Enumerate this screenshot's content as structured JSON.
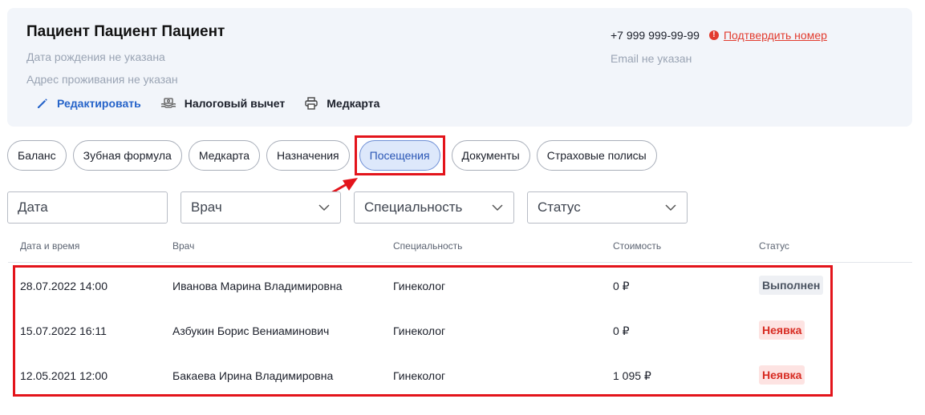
{
  "patient": {
    "name": "Пациент Пациент Пациент",
    "birth_date": "Дата рождения не указана",
    "address": "Адрес проживания не указан",
    "phone": "+7 999 999-99-99",
    "confirm_link": "Подтвердить номер",
    "email": "Email не указан",
    "warn_glyph": "!"
  },
  "actions": {
    "edit": "Редактировать",
    "tax": "Налоговый вычет",
    "medcard": "Медкарта"
  },
  "tabs": [
    {
      "label": "Баланс"
    },
    {
      "label": "Зубная формула"
    },
    {
      "label": "Медкарта"
    },
    {
      "label": "Назначения"
    },
    {
      "label": "Посещения",
      "active": true
    },
    {
      "label": "Документы"
    },
    {
      "label": "Страховые полисы"
    }
  ],
  "filters": {
    "date_placeholder": "Дата",
    "doctor": "Врач",
    "specialty": "Специальность",
    "status": "Статус"
  },
  "table": {
    "headers": [
      "Дата и время",
      "Врач",
      "Специальность",
      "Стоимость",
      "Статус"
    ],
    "rows": [
      {
        "datetime": "28.07.2022 14:00",
        "doctor": "Иванова Марина Владимировна",
        "specialty": "Гинеколог",
        "cost": "0 ₽",
        "status": "Выполнен"
      },
      {
        "datetime": "15.07.2022 16:11",
        "doctor": "Азбукин Борис Вениаминович",
        "specialty": "Гинеколог",
        "cost": "0 ₽",
        "status": "Неявка"
      },
      {
        "datetime": "12.05.2021 12:00",
        "doctor": "Бакаева Ирина Владимировна",
        "specialty": "Гинеколог",
        "cost": "1 095 ₽",
        "status": "Неявка"
      }
    ]
  },
  "colors": {
    "accent": "#2563c9",
    "annotation": "#e3141b",
    "noshow": "#d72b22"
  }
}
